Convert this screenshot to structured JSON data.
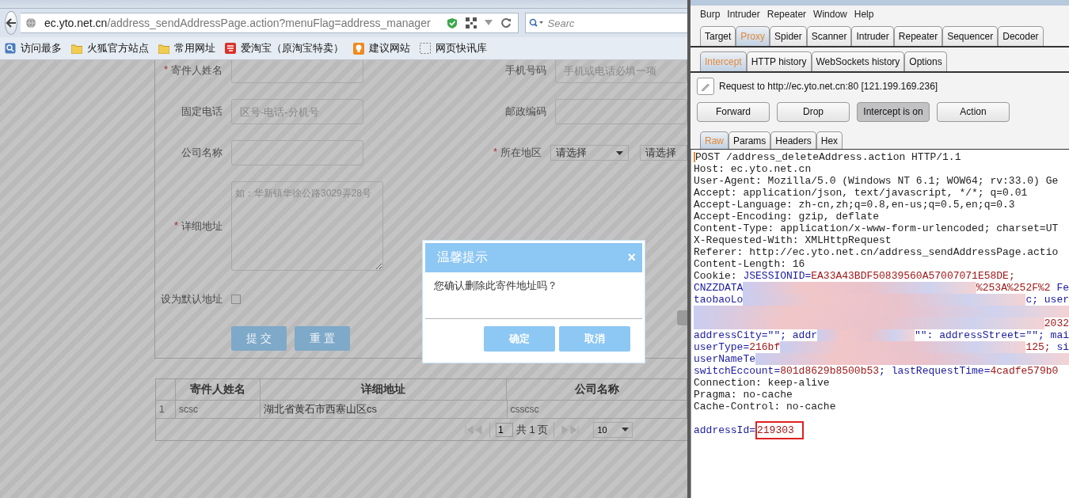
{
  "browser": {
    "address_bar": {
      "url": "**ec.yto.net.cn**/address_sendAddressPage.action?menuFlag=address_manager"
    },
    "search": {
      "placeholder": "Searc"
    },
    "bookmarks": [
      {
        "label": "访问最多",
        "kind": "list"
      },
      {
        "label": "火狐官方站点",
        "kind": "folder"
      },
      {
        "label": "常用网址",
        "kind": "folder"
      },
      {
        "label": "爱淘宝（原淘宝特卖）",
        "kind": "red"
      },
      {
        "label": "建议网站",
        "kind": "bulb"
      },
      {
        "label": "网页快讯库",
        "kind": "dashed"
      }
    ]
  },
  "form": {
    "rows": [
      {
        "cells": [
          {
            "kind": "input",
            "mark": "*",
            "label": "寄件人姓名"
          },
          {
            "kind": "input",
            "label": "手机号码",
            "placeholder": "手机或电话必填一项"
          }
        ]
      },
      {
        "cells": [
          {
            "kind": "input",
            "label": "固定电话",
            "placeholder": "区号-电话-分机号"
          },
          {
            "kind": "input",
            "label": "邮政编码"
          }
        ]
      },
      {
        "cells": [
          {
            "kind": "input",
            "label": "公司名称"
          },
          {
            "kind": "selects",
            "mark": "*",
            "label": "所在地区",
            "selects": [
              "请选择",
              "请选择"
            ]
          }
        ]
      },
      {
        "cells": [
          {
            "kind": "textarea",
            "mark": "*",
            "label": "详细地址",
            "placeholder": "如：华新镇华徐公路3029弄28号"
          }
        ]
      },
      {
        "cells": [
          {
            "kind": "checkbox",
            "label": "设为默认地址",
            "checked": false
          }
        ]
      }
    ],
    "buttons": [
      "提 交",
      "重 置"
    ]
  },
  "table": {
    "columns": [
      "寄件人姓名",
      "详细地址",
      "公司名称"
    ],
    "rows": [
      {
        "index": "1",
        "cells": [
          "scsc",
          "湖北省黄石市西塞山区cs",
          "csscsc"
        ]
      }
    ],
    "pager": {
      "page": "1",
      "total": "共 1 页",
      "page_size": "10"
    }
  },
  "dialog": {
    "title": "温馨提示",
    "close": "×",
    "message": "您确认删除此寄件地址吗？",
    "buttons": [
      "确定",
      "取消"
    ]
  },
  "burp": {
    "menu": [
      "Burp",
      "Intruder",
      "Repeater",
      "Window",
      "Help"
    ],
    "tabs": [
      {
        "label": "Target",
        "selected": false
      },
      {
        "label": "Proxy",
        "selected": true
      },
      {
        "label": "Spider",
        "selected": false
      },
      {
        "label": "Scanner",
        "selected": false
      },
      {
        "label": "Intruder",
        "selected": false
      },
      {
        "label": "Repeater",
        "selected": false
      },
      {
        "label": "Sequencer",
        "selected": false
      },
      {
        "label": "Decoder",
        "selected": false
      }
    ],
    "subtabs": [
      {
        "label": "Intercept",
        "selected": true
      },
      {
        "label": "HTTP history",
        "selected": false
      },
      {
        "label": "WebSockets history",
        "selected": false
      },
      {
        "label": "Options",
        "selected": false
      }
    ],
    "request_info": "Request to http://ec.yto.net.cn:80  [121.199.169.236]",
    "buttons": [
      {
        "label": "Forward",
        "pressed": false
      },
      {
        "label": "Drop",
        "pressed": false
      },
      {
        "label": "Intercept is on",
        "pressed": true
      },
      {
        "label": "Action",
        "pressed": false
      }
    ],
    "editor_tabs": [
      {
        "label": "Raw",
        "selected": true
      },
      {
        "label": "Params",
        "selected": false
      },
      {
        "label": "Headers",
        "selected": false
      },
      {
        "label": "Hex",
        "selected": false
      }
    ],
    "lines": [
      [
        {
          "kind": "plain",
          "text": "POST /address_deleteAddress.action HTTP/1.1"
        }
      ],
      [
        {
          "kind": "plain",
          "text": "Host: ec.yto.net.cn"
        }
      ],
      [
        {
          "kind": "plain",
          "text": "User-Agent: Mozilla/5.0 (Windows NT 6.1; WOW64; rv:33.0) Ge"
        }
      ],
      [
        {
          "kind": "plain",
          "text": "Accept: application/json, text/javascript, */*; q=0.01"
        }
      ],
      [
        {
          "kind": "plain",
          "text": "Accept-Language: zh-cn,zh;q=0.8,en-us;q=0.5,en;q=0.3"
        }
      ],
      [
        {
          "kind": "plain",
          "text": "Accept-Encoding: gzip, deflate"
        }
      ],
      [
        {
          "kind": "plain",
          "text": "Content-Type: application/x-www-form-urlencoded; charset=UT"
        }
      ],
      [
        {
          "kind": "plain",
          "text": "X-Requested-With: XMLHttpRequest"
        }
      ],
      [
        {
          "kind": "plain",
          "text": "Referer: http://ec.yto.net.cn/address_sendAddressPage.actio"
        }
      ],
      [
        {
          "kind": "plain",
          "text": "Content-Length: 16"
        }
      ],
      [
        {
          "kind": "plain",
          "text": "Cookie: "
        },
        {
          "kind": "name",
          "text": "JSESSIONID="
        },
        {
          "kind": "value",
          "text": "EA33A43BDF50839560A57007071E58DE;"
        }
      ],
      [
        {
          "kind": "name",
          "text": "CNZZDATA"
        },
        {
          "kind": "redacted"
        },
        {
          "kind": "value",
          "text": "%253A%252F%2"
        },
        {
          "kind": "name",
          "text": " Fe"
        }
      ],
      [
        {
          "kind": "name",
          "text": "taobaoLo"
        },
        {
          "kind": "redacted"
        },
        {
          "kind": "name",
          "text": "c; user"
        }
      ],
      [
        {
          "kind": "redacted"
        }
      ],
      [
        {
          "kind": "redacted"
        },
        {
          "kind": "value",
          "text": "2032"
        }
      ],
      [
        {
          "kind": "name",
          "text": "addressCity=\"\"; addr"
        },
        {
          "kind": "redacted"
        },
        {
          "kind": "name",
          "text": "\"\": addressStreet=\"\"; mai"
        }
      ],
      [
        {
          "kind": "name",
          "text": "userType="
        },
        {
          "kind": "value",
          "text": "216bf"
        },
        {
          "kind": "redacted"
        },
        {
          "kind": "value",
          "text": "125;"
        },
        {
          "kind": "name",
          "text": " si"
        }
      ],
      [
        {
          "kind": "name",
          "text": "userNameTe"
        },
        {
          "kind": "redacted"
        }
      ],
      [
        {
          "kind": "name",
          "text": "switchEccount="
        },
        {
          "kind": "value",
          "text": "801d8629b8500b53"
        },
        {
          "kind": "name",
          "text": "; lastRequestTime="
        },
        {
          "kind": "value",
          "text": "4cadfe579b0"
        }
      ],
      [
        {
          "kind": "plain",
          "text": "Connection: keep-alive"
        }
      ],
      [
        {
          "kind": "plain",
          "text": "Pragma: no-cache"
        }
      ],
      [
        {
          "kind": "plain",
          "text": "Cache-Control: no-cache"
        }
      ]
    ],
    "body": [
      [
        {
          "kind": "name",
          "text": "addressId="
        },
        {
          "kind": "boxed-value",
          "text": "219303"
        }
      ]
    ]
  }
}
